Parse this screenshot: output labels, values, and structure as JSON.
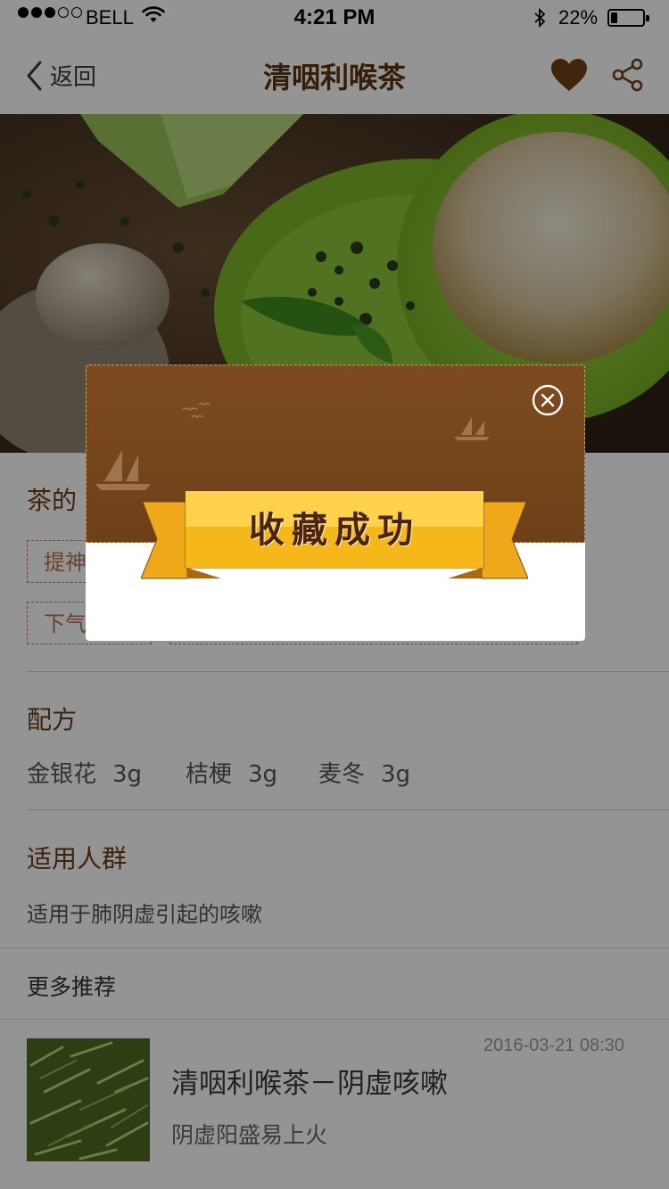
{
  "status_bar": {
    "carrier": "BELL",
    "time": "4:21 PM",
    "battery_percent": "22%",
    "battery_level": 0.22,
    "signal_bars_filled": 3,
    "signal_bars_total": 5
  },
  "nav": {
    "back_label": "返回",
    "title": "清咽利喉茶",
    "favorited": true
  },
  "effects": {
    "title": "茶的",
    "tags": [
      "提神",
      "下气"
    ]
  },
  "recipe": {
    "title": "配方",
    "items": [
      {
        "name": "金银花",
        "qty": "3g"
      },
      {
        "name": "桔梗",
        "qty": "3g"
      },
      {
        "name": "麦冬",
        "qty": "3g"
      }
    ]
  },
  "audience": {
    "title": "适用人群",
    "text": "适用于肺阴虚引起的咳嗽"
  },
  "more": {
    "title": "更多推荐",
    "items": [
      {
        "date": "2016-03-21 08:30",
        "title": "清咽利喉茶－阴虚咳嗽",
        "subtitle": "阴虚阳盛易上火"
      }
    ]
  },
  "modal": {
    "message": "收藏成功"
  },
  "colors": {
    "brand_brown": "#7a4a1f",
    "title_brown": "#5c3310",
    "ribbon_gold": "#f5c020",
    "tag_border": "#b57a4d"
  }
}
